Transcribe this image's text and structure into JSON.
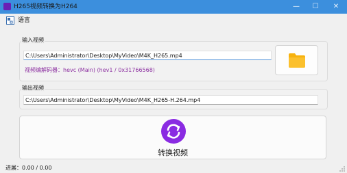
{
  "window": {
    "title": "H265视频转换为H264",
    "min_glyph": "—",
    "max_glyph": "☐",
    "close_glyph": "✕"
  },
  "menu": {
    "language_label": "语言"
  },
  "input": {
    "group_title": "输入视频",
    "path_value": "C:\\Users\\Administrator\\Desktop\\MyVideo\\M4K_H265.mp4",
    "codec_info": "视频编解码器：hevc (Main) (hev1 / 0x31766568)"
  },
  "output": {
    "group_title": "输出视频",
    "path_value": "C:\\Users\\Administrator\\Desktop\\MyVideo\\M4K_H265-H.264.mp4"
  },
  "convert": {
    "label": "转换视频"
  },
  "status": {
    "progress_text": "进展：0.00 / 0.00"
  },
  "colors": {
    "titlebar": "#3c8fdd",
    "accent_purple": "#8a2be2",
    "codec_text": "#8c2fa0",
    "folder": "#f7b20e"
  },
  "icons": {
    "app": "app-icon",
    "language": "language-icon",
    "folder": "folder-icon",
    "convert": "refresh-icon"
  }
}
